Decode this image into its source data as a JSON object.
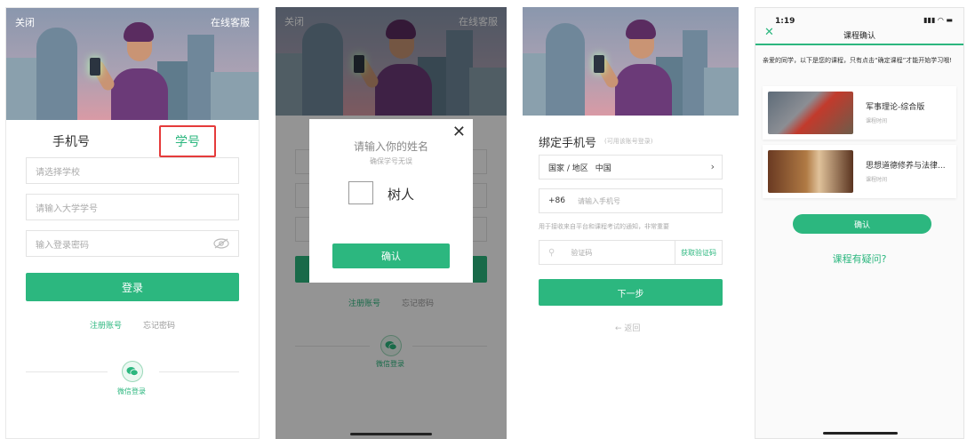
{
  "screen1": {
    "close_label": "关闭",
    "service_label": "在线客服",
    "tab_phone": "手机号",
    "tab_student": "学号",
    "school_placeholder": "请选择学校",
    "student_id_placeholder": "请输入大学学号",
    "password_placeholder": "输入登录密码",
    "login_label": "登录",
    "register_label": "注册账号",
    "forgot_label": "忘记密码",
    "wechat_label": "微信登录"
  },
  "screen2": {
    "close_label": "关闭",
    "service_label": "在线客服",
    "modal_title": "请输入你的姓名",
    "modal_subtitle": "确保学号无误",
    "name_option": "树人",
    "confirm_label": "确认",
    "register_label": "注册账号",
    "forgot_label": "忘记密码",
    "wechat_label": "微信登录"
  },
  "screen3": {
    "title": "绑定手机号",
    "title_hint": "(可用该账号登录)",
    "region_label": "国家 / 地区",
    "region_value": "中国",
    "country_code": "+86",
    "phone_placeholder": "请输入手机号",
    "notice": "用于接收来自平台和课程考试的通知，非常重要",
    "code_placeholder": "验证码",
    "get_code_label": "获取验证码",
    "next_label": "下一步",
    "back_label": "返回"
  },
  "screen4": {
    "time": "1:19",
    "title": "课程确认",
    "intro": "亲爱的同学，以下是您的课程，只有点击“确定课程”才能开始学习哦!",
    "courses": [
      {
        "name": "军事理论-综合版",
        "meta": "课程时间"
      },
      {
        "name": "思想道德修养与法律...",
        "meta": "课程时间"
      }
    ],
    "confirm_label": "确认",
    "question_label": "课程有疑问?"
  },
  "colors": {
    "accent": "#2cb77f",
    "highlight_border": "#e53b3b"
  }
}
